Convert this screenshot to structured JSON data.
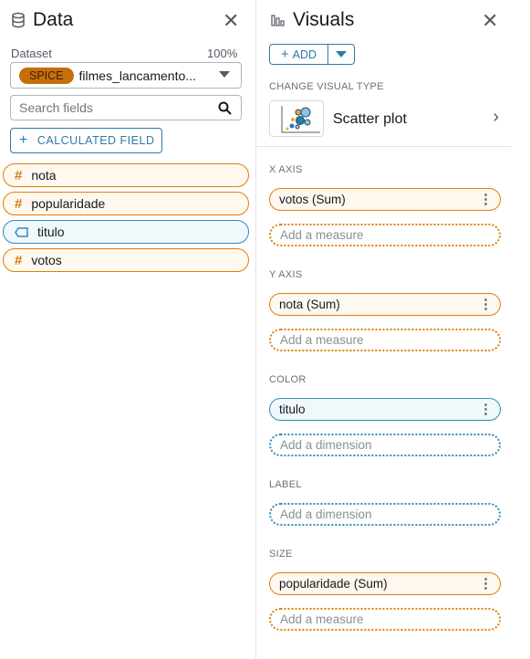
{
  "data_panel": {
    "title": "Data",
    "dataset_label": "Dataset",
    "dataset_percent": "100%",
    "spice_badge": "SPICE",
    "dataset_name": "filmes_lancamento...",
    "search_placeholder": "Search fields",
    "calc_field": "CALCULATED FIELD",
    "fields": [
      {
        "name": "nota",
        "type": "measure"
      },
      {
        "name": "popularidade",
        "type": "measure"
      },
      {
        "name": "titulo",
        "type": "dimension"
      },
      {
        "name": "votos",
        "type": "measure"
      }
    ]
  },
  "visuals_panel": {
    "title": "Visuals",
    "add": "ADD",
    "change_type_label": "CHANGE VISUAL TYPE",
    "visual_type": "Scatter plot",
    "wells": [
      {
        "label": "X AXIS",
        "field": "votos (Sum)",
        "placeholder": "Add a measure"
      },
      {
        "label": "Y AXIS",
        "field": "nota (Sum)",
        "placeholder": "Add a measure"
      },
      {
        "label": "COLOR",
        "field": "titulo",
        "placeholder": "Add a dimension"
      },
      {
        "label": "LABEL",
        "placeholder": "Add a dimension"
      },
      {
        "label": "SIZE",
        "field": "popularidade (Sum)",
        "placeholder": "Add a measure"
      }
    ]
  },
  "colors": {
    "measure": "#e07f0a",
    "dimension": "#2e8bc0",
    "spice": "#c76e0b"
  }
}
